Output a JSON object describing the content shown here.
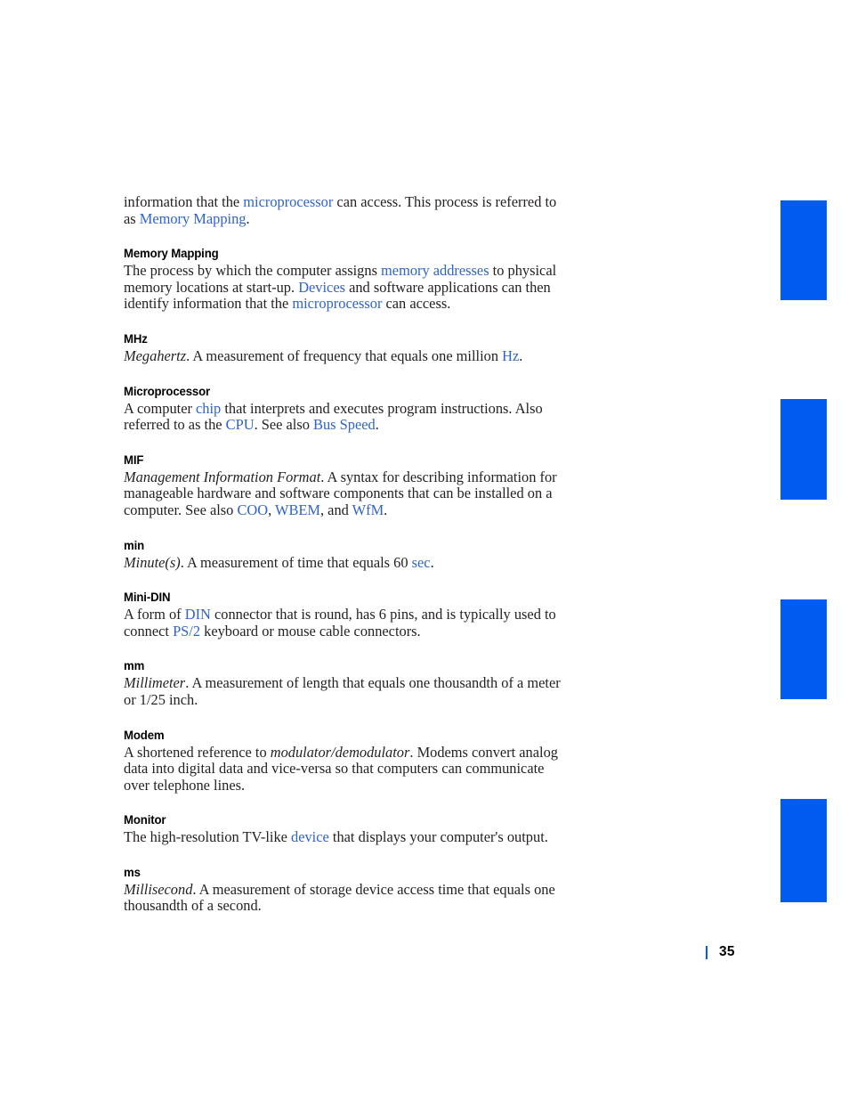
{
  "page": {
    "number": "35",
    "accent_color": "#005bf0",
    "link_color": "#2f63c8",
    "text_color": "#231f20"
  },
  "tabs": [
    {
      "name": "index-tab-1"
    },
    {
      "name": "index-tab-2"
    },
    {
      "name": "index-tab-3"
    },
    {
      "name": "index-tab-4"
    }
  ],
  "continued_paragraph": {
    "part1": "information that the ",
    "link1": "microprocessor",
    "part2": " can access. This process is referred to as ",
    "link2": "Memory Mapping",
    "part3": "."
  },
  "entries": [
    {
      "term": "Memory Mapping",
      "body": {
        "part1": "The process by which the computer assigns ",
        "link1": "memory addresses",
        "part2": " to physical memory locations at start-up. ",
        "link2": "Devices",
        "part3": " and software applications can then identify information that the ",
        "link3": "microprocessor",
        "part4": " can access."
      }
    },
    {
      "term": "MHz",
      "body": {
        "italic1": "Megahertz",
        "part1": ". A measurement of frequency that equals one million ",
        "link1": "Hz",
        "part2": "."
      }
    },
    {
      "term": "Microprocessor",
      "body": {
        "part1": "A computer ",
        "link1": "chip",
        "part2": " that interprets and executes program instructions. Also referred to as the ",
        "link2": "CPU",
        "part3": ". See also ",
        "link3": "Bus Speed",
        "part4": "."
      }
    },
    {
      "term": "MIF",
      "body": {
        "italic1": "Management Information Format",
        "part1": ". A syntax for describing information for manageable hardware and software components that can be installed on a computer. See also ",
        "link1": "COO",
        "part2": ", ",
        "link2": "WBEM",
        "part3": ", and ",
        "link3": "WfM",
        "part4": "."
      }
    },
    {
      "term": "min",
      "body": {
        "italic1": "Minute(s)",
        "part1": ". A measurement of time that equals 60 ",
        "link1": "sec",
        "part2": "."
      }
    },
    {
      "term": "Mini-DIN",
      "body": {
        "part1": "A form of ",
        "link1": "DIN",
        "part2": " connector that is round, has 6 pins, and is typically used to connect ",
        "link2": "PS/2",
        "part3": " keyboard or mouse cable connectors."
      }
    },
    {
      "term": "mm",
      "body": {
        "italic1": "Millimeter",
        "part1": ". A measurement of length that equals one thousandth of a meter or 1/25 inch."
      }
    },
    {
      "term": "Modem",
      "body": {
        "part1": "A shortened reference to ",
        "italic1": "modulator/demodulator",
        "part2": ". Modems convert analog data into digital data and vice-versa so that computers can communicate over telephone lines."
      }
    },
    {
      "term": "Monitor",
      "body": {
        "part1": "The high-resolution TV-like ",
        "link1": "device",
        "part2": " that displays your computer's output."
      }
    },
    {
      "term": "ms",
      "body": {
        "italic1": "Millisecond",
        "part1": ". A measurement of storage device access time that equals one thousandth of a second."
      }
    }
  ]
}
